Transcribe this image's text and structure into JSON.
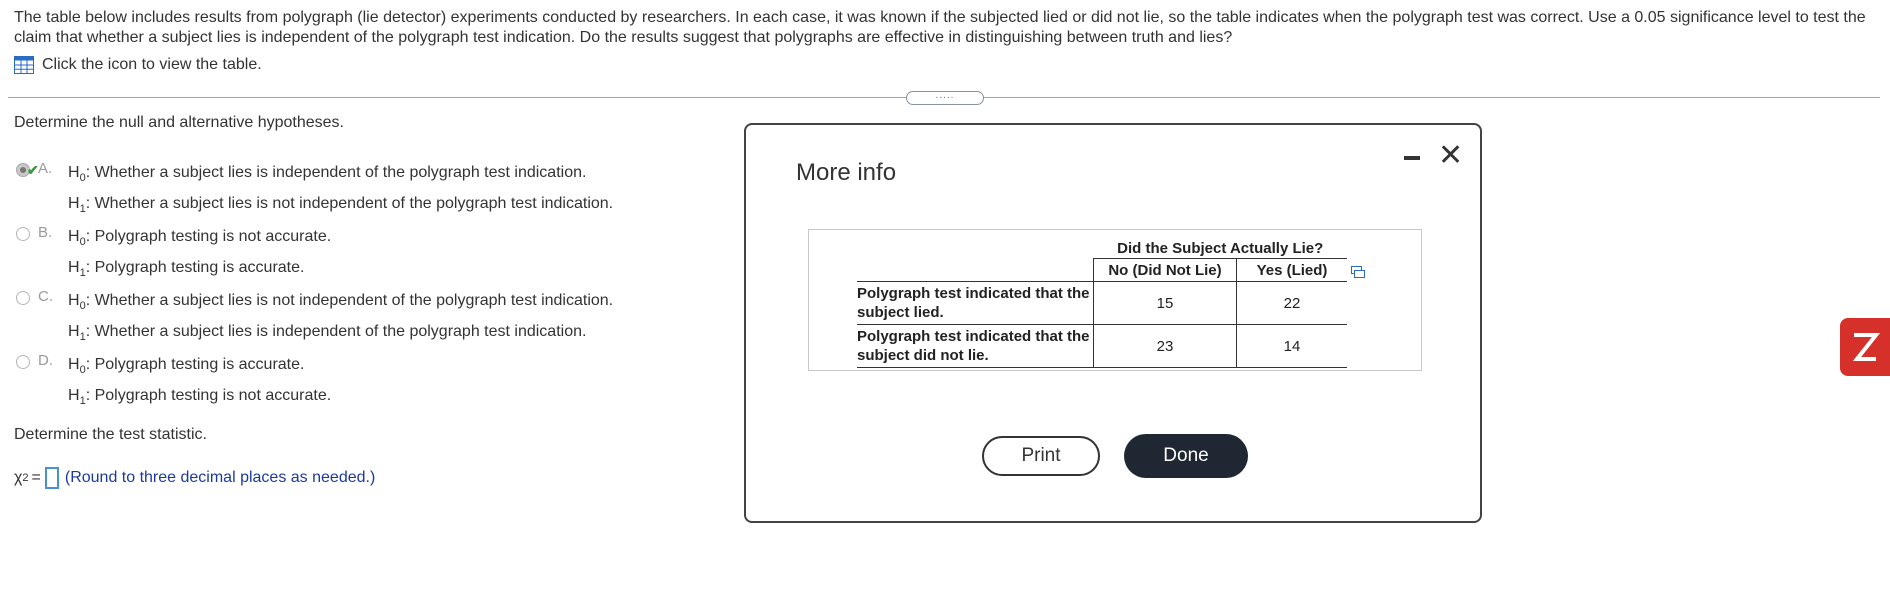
{
  "question": {
    "text": "The table below includes results from polygraph (lie detector) experiments conducted by researchers. In each case, it was known if the subjected lied or did not lie, so the table indicates when the polygraph test was correct. Use a 0.05 significance level to test the claim that whether a subject lies is independent of the polygraph test indication. Do the results suggest that polygraphs are effective in distinguishing between truth and lies?",
    "view_link": "Click the icon to view the table."
  },
  "part1": {
    "label": "Determine the null and alternative hypotheses.",
    "h0_symbol": "H",
    "h0_sub": "0",
    "h1_symbol": "H",
    "h1_sub": "1",
    "options": [
      {
        "letter": "A.",
        "h0": "Whether a subject lies is independent of the polygraph test indication.",
        "h1": "Whether a subject lies is not independent of the polygraph test indication."
      },
      {
        "letter": "B.",
        "h0": "Polygraph testing is not accurate.",
        "h1": "Polygraph testing is accurate."
      },
      {
        "letter": "C.",
        "h0": "Whether a subject lies is not independent of the polygraph test indication.",
        "h1": "Whether a subject lies is independent of the polygraph test indication."
      },
      {
        "letter": "D.",
        "h0": "Polygraph testing is accurate.",
        "h1": "Polygraph testing is not accurate."
      }
    ],
    "selected": "A."
  },
  "part2": {
    "label": "Determine the test statistic.",
    "chi_symbol": "χ",
    "chi_sup": "2",
    "equals": "=",
    "hint": "(Round to three decimal places as needed.)"
  },
  "drag_handle": ".....",
  "modal": {
    "title": "More info",
    "table": {
      "top_header": "Did the Subject Actually Lie?",
      "col_headers": [
        "No (Did Not Lie)",
        "Yes (Lied)"
      ],
      "rows": [
        {
          "label": "Polygraph test indicated that the subject lied.",
          "values": [
            "15",
            "22"
          ]
        },
        {
          "label": "Polygraph test indicated that the subject did not lie.",
          "values": [
            "23",
            "14"
          ]
        }
      ]
    },
    "print_label": "Print",
    "done_label": "Done"
  },
  "colors": {
    "accent": "#1e2732",
    "side_tab": "#d6302a",
    "hint": "#1c3a9e",
    "check": "#3a9a3a"
  }
}
